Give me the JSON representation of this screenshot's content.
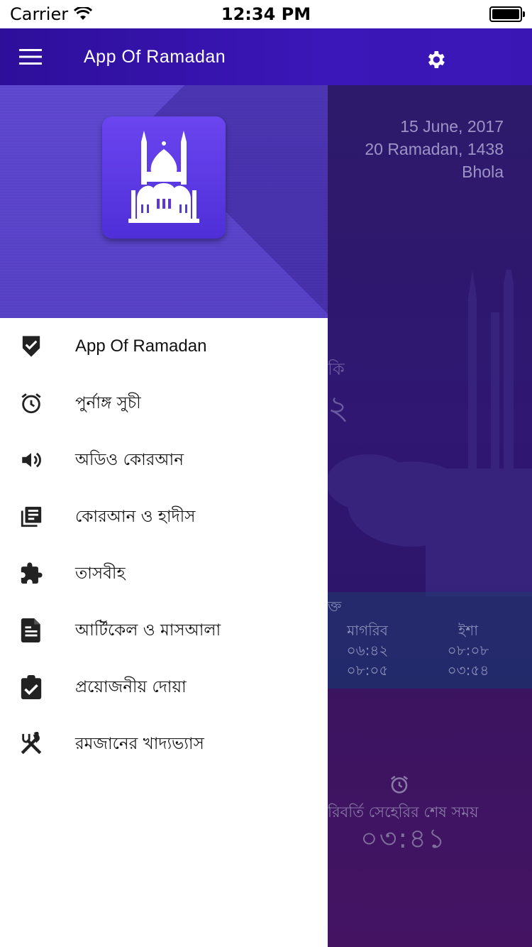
{
  "status_bar": {
    "carrier": "Carrier",
    "time": "12:34 PM"
  },
  "app_bar": {
    "title": "App Of Ramadan",
    "menu_icon": "hamburger-icon",
    "settings_icon": "gear-icon"
  },
  "main": {
    "date_gregorian": "15 June, 2017",
    "date_hijri": "20 Ramadan, 1438",
    "location": "Bhola",
    "partial_top_label": "কি",
    "partial_big_number": "২",
    "times_header_partial": "ক্ত",
    "prayers": [
      {
        "name": "মাগরিব",
        "start": "০৬:৪২",
        "end": "০৮:০৫"
      },
      {
        "name": "ইশা",
        "start": "০৮:০৮",
        "end": "০৩:৫৪"
      }
    ],
    "sehri_label": "রিবর্তি সেহেরির শেষ সময়",
    "sehri_time": "০৩:৪১"
  },
  "drawer": {
    "items": [
      {
        "label": "App Of Ramadan",
        "icon": "shield-check-icon"
      },
      {
        "label": "পুর্নাঙ্গ সুচী",
        "icon": "alarm-clock-icon"
      },
      {
        "label": "অডিও কোরআন",
        "icon": "speaker-icon"
      },
      {
        "label": "কোরআন ও হাদীস",
        "icon": "library-books-icon"
      },
      {
        "label": "তাসবীহ",
        "icon": "puzzle-icon"
      },
      {
        "label": "আর্টিকেল ও মাসআলা",
        "icon": "document-icon"
      },
      {
        "label": "প্রয়োজনীয় দোয়া",
        "icon": "clipboard-check-icon"
      },
      {
        "label": "রমজানের খাদ্যভ্যাস",
        "icon": "fork-knife-icon"
      }
    ]
  },
  "colors": {
    "appbar": "#3b16b8",
    "drawer_header": "#5a43c8",
    "app_icon": "#5a35e0"
  }
}
